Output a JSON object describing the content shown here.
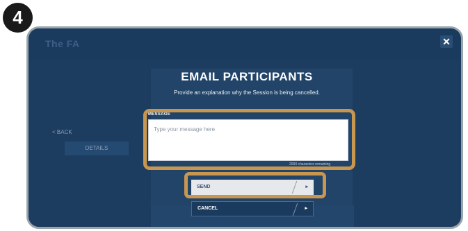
{
  "step": {
    "number": "4"
  },
  "app": {
    "brand": "The FA",
    "close_icon": "close-icon"
  },
  "background": {
    "back_label": "<  BACK",
    "details_tab": "DETAILS"
  },
  "dialog": {
    "title": "EMAIL PARTICIPANTS",
    "subtitle": "Provide an explanation why the Session is being cancelled.",
    "message_label": "MESSAGE",
    "message_placeholder": "Type your message here",
    "counter": "2000 characters remaining",
    "send_label": "SEND",
    "cancel_label": "CANCEL",
    "arrow": "▸"
  },
  "colors": {
    "highlight": "#c8964f",
    "overlay": "#1d3d60"
  }
}
